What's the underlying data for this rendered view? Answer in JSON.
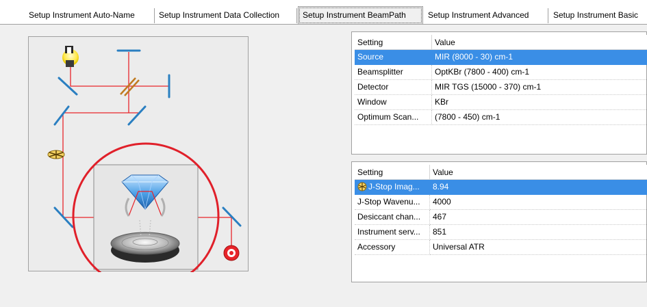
{
  "tabs": [
    {
      "label": "Setup Instrument Auto-Name",
      "active": false
    },
    {
      "label": "Setup Instrument Data Collection",
      "active": false
    },
    {
      "label": "Setup Instrument BeamPath",
      "active": true
    },
    {
      "label": "Setup Instrument Advanced",
      "active": false
    },
    {
      "label": "Setup Instrument Basic",
      "active": false
    }
  ],
  "beampath": {
    "accent_colors": {
      "beam": "#e8242a",
      "mirror": "#2a7fc1",
      "highlight_circle": "#e0202a"
    }
  },
  "optics_grid": {
    "columns": [
      "Setting",
      "Value"
    ],
    "rows": [
      {
        "setting": "Source",
        "value": "MIR (8000 - 30) cm-1",
        "selected": true
      },
      {
        "setting": "Beamsplitter",
        "value": "OptKBr (7800 - 400) cm-1",
        "selected": false
      },
      {
        "setting": "Detector",
        "value": "MIR TGS (15000 - 370) cm-1",
        "selected": false
      },
      {
        "setting": "Window",
        "value": "KBr",
        "selected": false
      },
      {
        "setting": "Optimum Scan...",
        "value": "(7800 - 450) cm-1",
        "selected": false
      }
    ]
  },
  "status_grid": {
    "columns": [
      "Setting",
      "Value"
    ],
    "rows": [
      {
        "setting": "J-Stop Imag...",
        "value": "8.94",
        "selected": true,
        "icon": "j-stop-icon"
      },
      {
        "setting": "J-Stop Wavenu...",
        "value": "4000",
        "selected": false
      },
      {
        "setting": "Desiccant chan...",
        "value": "467",
        "selected": false
      },
      {
        "setting": "Instrument serv...",
        "value": "851",
        "selected": false
      },
      {
        "setting": "Accessory",
        "value": "Universal ATR",
        "selected": false
      }
    ]
  },
  "colors": {
    "selection": "#3a8ee6",
    "panel": "#f0f0f0"
  }
}
